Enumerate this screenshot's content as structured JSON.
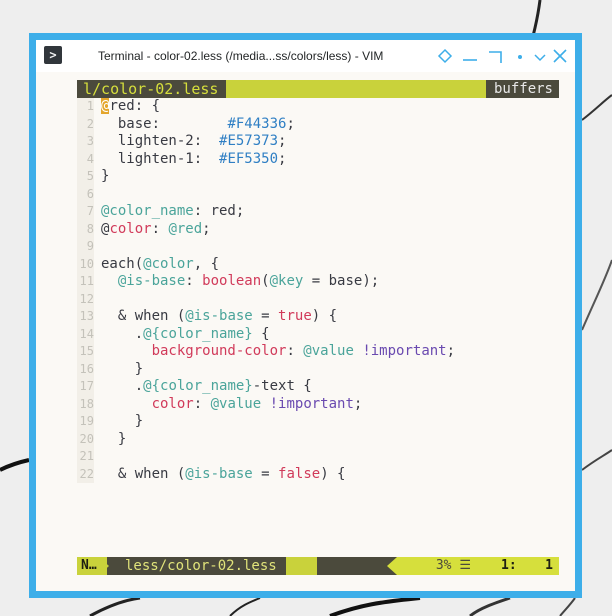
{
  "window": {
    "title": "Terminal - color-02.less (/media...ss/colors/less) - VIM",
    "icon": "terminal-icon",
    "controls": [
      "sticky-icon",
      "minimize-icon",
      "maximize-icon",
      "dot-icon",
      "chevron-down-icon",
      "close-icon"
    ]
  },
  "vim": {
    "tab_current": "l/color-02.less",
    "tab_buffers": "buffers",
    "lines": [
      {
        "n": "1",
        "t": "@red: {"
      },
      {
        "n": "2",
        "t": "  base:        #F44336;"
      },
      {
        "n": "3",
        "t": "  lighten-2:  #E57373;"
      },
      {
        "n": "4",
        "t": "  lighten-1:  #EF5350;"
      },
      {
        "n": "5",
        "t": "}"
      },
      {
        "n": "6",
        "t": ""
      },
      {
        "n": "7",
        "t": "@color_name: red;"
      },
      {
        "n": "8",
        "t": "@color: @red;"
      },
      {
        "n": "9",
        "t": ""
      },
      {
        "n": "10",
        "t": "each(@color, {"
      },
      {
        "n": "11",
        "t": "  @is-base: boolean(@key = base);"
      },
      {
        "n": "12",
        "t": ""
      },
      {
        "n": "13",
        "t": "  & when (@is-base = true) {"
      },
      {
        "n": "14",
        "t": "    .@{color_name} {"
      },
      {
        "n": "15",
        "t": "      background-color: @value !important;"
      },
      {
        "n": "16",
        "t": "    }"
      },
      {
        "n": "17",
        "t": "    .@{color_name}-text {"
      },
      {
        "n": "18",
        "t": "      color: @value !important;"
      },
      {
        "n": "19",
        "t": "    }"
      },
      {
        "n": "20",
        "t": "  }"
      },
      {
        "n": "21",
        "t": ""
      },
      {
        "n": "22",
        "t": "  & when (@is-base = false) {"
      }
    ],
    "status": {
      "mode": "N…",
      "file": "less/color-02.less",
      "percent": "3% ☰",
      "line": "1:",
      "col": "1"
    }
  },
  "colors": {
    "accent_border": "#3daee9",
    "airline_green": "#c9d23b",
    "airline_dark": "#4b4a3c",
    "cursor": "#e4a62c"
  }
}
